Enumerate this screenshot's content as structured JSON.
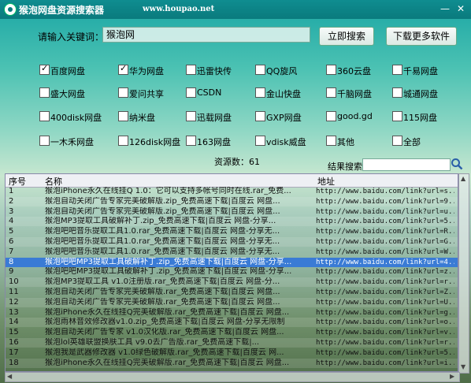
{
  "window": {
    "title": "猴泡网盘资源搜索器",
    "url": "www.houpao.net",
    "minimize": "—",
    "close": "✕"
  },
  "search": {
    "label": "请输入关键词：",
    "value": "猴泡网",
    "search_button": "立即搜索",
    "more_button": "下载更多软件"
  },
  "sources": [
    {
      "label": "百度网盘",
      "checked": true
    },
    {
      "label": "华为网盘",
      "checked": true
    },
    {
      "label": "迅雷快传",
      "checked": false
    },
    {
      "label": "QQ旋风",
      "checked": false
    },
    {
      "label": "360云盘",
      "checked": false
    },
    {
      "label": "千易网盘",
      "checked": false
    },
    {
      "label": "盛大网盘",
      "checked": false
    },
    {
      "label": "爱问共享",
      "checked": false
    },
    {
      "label": "CSDN",
      "checked": false
    },
    {
      "label": "金山快盘",
      "checked": false
    },
    {
      "label": "千脑网盘",
      "checked": false
    },
    {
      "label": "城通网盘",
      "checked": false
    },
    {
      "label": "400disk网盘",
      "checked": false
    },
    {
      "label": "纳米盘",
      "checked": false
    },
    {
      "label": "迅载网盘",
      "checked": false
    },
    {
      "label": "GXP网盘",
      "checked": false
    },
    {
      "label": "good.gd",
      "checked": false
    },
    {
      "label": "115网盘",
      "checked": false
    },
    {
      "label": "一木禾网盘",
      "checked": false
    },
    {
      "label": "126disk网盘",
      "checked": false
    },
    {
      "label": "163网盘",
      "checked": false
    },
    {
      "label": "vdisk威盘",
      "checked": false
    },
    {
      "label": "其他",
      "checked": false
    },
    {
      "label": "全部",
      "checked": false
    }
  ],
  "results": {
    "count_label": "资源数：61",
    "filter_label": "结果搜索",
    "filter_value": "",
    "columns": [
      "序号",
      "名称",
      "地址"
    ],
    "rows": [
      [
        "1",
        "猴泡iPhone永久在线挂Q 1.0：它可以支持多帐号同时在线.rar_免费...",
        "http://www.baidu.com/link?url=s..."
      ],
      [
        "2",
        "猴泡自动关闭广告专家完美破解版.zip_免费高速下载|百度云 网盘...",
        "http://www.baidu.com/link?url=9..."
      ],
      [
        "3",
        "猴泡自动关闭广告专家完美破解版.zip_免费高速下载|百度云 网盘...",
        "http://www.baidu.com/link?url=u..."
      ],
      [
        "4",
        "猴泡MP3提取工具破解补丁.zip_免费高速下载|百度云 网盘-分享...",
        "http://www.baidu.com/link?url=5..."
      ],
      [
        "5",
        "猴泡吧吧音乐提取工具1.0.rar_免费高速下载|百度云 网盘-分享无...",
        "http://www.baidu.com/link?url=R..."
      ],
      [
        "6",
        "猴泡吧吧音乐提取工具1.0.rar_免费高速下载|百度云 网盘-分享无...",
        "http://www.baidu.com/link?url=G..."
      ],
      [
        "7",
        "猴泡吧吧音乐提取工具1.0.rar_免费高速下载|百度云 网盘-分享无...",
        "http://www.baidu.com/link?url=W..."
      ],
      [
        "8",
        "猴泡吧吧MP3提取工具破解补丁.zip_免费高速下载|百度云 网盘-分享...",
        "http://www.baidu.com/link?url=4..."
      ],
      [
        "9",
        "猴泡吧吧MP3提取工具破解补丁.zip_免费高速下载|百度云 网盘-分享...",
        "http://www.baidu.com/link?url=z..."
      ],
      [
        "10",
        "猴泡MP3提取工具 v1.0注册版.rar_免费高速下载|百度云 网盘-分...",
        "http://www.baidu.com/link?url=r..."
      ],
      [
        "11",
        "猴泡自动关闭广告专家完美破解版.rar_免费高速下载|百度云 网盘...",
        "http://www.baidu.com/link?url=Z..."
      ],
      [
        "12",
        "猴泡自动关闭广告专家完美破解版.rar_免费高速下载|百度云 网盘...",
        "http://www.baidu.com/link?url=U..."
      ],
      [
        "13",
        "猴泡iPhone永久在线挂Q完美破解版.rar_免费高速下载|百度云 网盘...",
        "http://www.baidu.com/link?url=g..."
      ],
      [
        "14",
        "猴泡雨林音效修改器v1.0.zip_免费高速下载|百度云 网盘-分享无限制",
        "http://www.baidu.com/link?url=o..."
      ],
      [
        "15",
        "猴泡自动关闭广告专家 v1.0汉化版.rar_免费高速下载|百度云 网盘...",
        "http://www.baidu.com/link?url=v..."
      ],
      [
        "16",
        "猴泡lol英雄联盟换肤工具 v9.0去广告版.rar_免费高速下载|...",
        "http://www.baidu.com/link?url=r..."
      ],
      [
        "17",
        "猴泡我是武器修改器 v1.0绿色破解版.rar_免费高速下载|百度云 网...",
        "http://www.baidu.com/link?url=5..."
      ],
      [
        "18",
        "猴泡iPhone永久在线挂Q完美破解版.rar_免费高速下载|百度云 网盘...",
        "http://www.baidu.com/link?url=i..."
      ]
    ],
    "selected_row": 7
  }
}
